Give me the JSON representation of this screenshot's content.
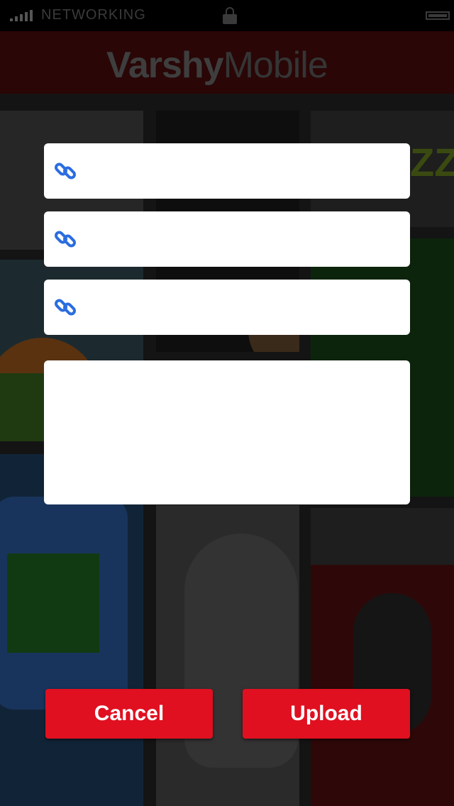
{
  "status_bar": {
    "carrier": "NETWORKING",
    "signal_icon": "signal-bars-icon",
    "lock_icon": "lock-icon",
    "battery_icon": "battery-icon"
  },
  "header": {
    "logo_part1": "Varshy",
    "logo_part2": "Mobile"
  },
  "form": {
    "link_fields": [
      {
        "icon": "link-icon",
        "value": "",
        "placeholder": ""
      },
      {
        "icon": "link-icon",
        "value": "",
        "placeholder": ""
      },
      {
        "icon": "link-icon",
        "value": "",
        "placeholder": ""
      }
    ],
    "description": {
      "value": "",
      "placeholder": ""
    }
  },
  "actions": {
    "cancel_label": "Cancel",
    "upload_label": "Upload"
  },
  "colors": {
    "accent": "#e01020",
    "link_icon": "#2b6de0",
    "overlay": "#000000"
  }
}
